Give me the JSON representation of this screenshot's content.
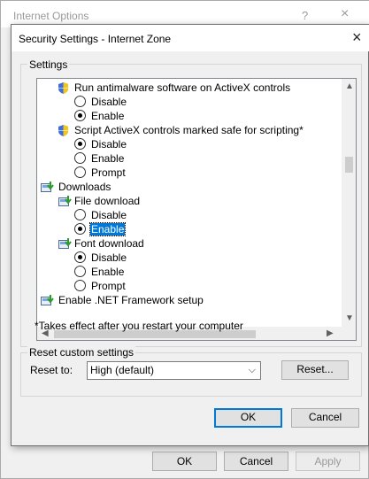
{
  "background_window": {
    "title": "Internet Options",
    "help_glyph": "?",
    "close_glyph": "×",
    "buttons": {
      "ok": "OK",
      "cancel": "Cancel",
      "apply": "Apply"
    }
  },
  "dialog": {
    "title": "Security Settings - Internet Zone",
    "close_glyph": "×",
    "settings_group_label": "Settings",
    "tree": {
      "rows": [
        {
          "kind": "setting",
          "icon": "shield-icon",
          "label": "Run antimalware software on ActiveX controls"
        },
        {
          "kind": "option",
          "label": "Disable",
          "checked": false
        },
        {
          "kind": "option",
          "label": "Enable",
          "checked": true
        },
        {
          "kind": "setting",
          "icon": "shield-icon",
          "label": "Script ActiveX controls marked safe for scripting*"
        },
        {
          "kind": "option",
          "label": "Disable",
          "checked": true
        },
        {
          "kind": "option",
          "label": "Enable",
          "checked": false
        },
        {
          "kind": "option",
          "label": "Prompt",
          "checked": false
        },
        {
          "kind": "category",
          "icon": "downloads-icon",
          "label": "Downloads"
        },
        {
          "kind": "setting",
          "icon": "download-setting-icon",
          "label": "File download"
        },
        {
          "kind": "option",
          "label": "Disable",
          "checked": false
        },
        {
          "kind": "option",
          "label": "Enable",
          "checked": true,
          "selected": true
        },
        {
          "kind": "setting",
          "icon": "download-setting-icon",
          "label": "Font download"
        },
        {
          "kind": "option",
          "label": "Disable",
          "checked": true
        },
        {
          "kind": "option",
          "label": "Enable",
          "checked": false
        },
        {
          "kind": "option",
          "label": "Prompt",
          "checked": false
        },
        {
          "kind": "category",
          "icon": "downloads-icon",
          "label": "Enable .NET Framework setup"
        }
      ]
    },
    "note": "*Takes effect after you restart your computer",
    "reset_group_label": "Reset custom settings",
    "reset_to_label": "Reset to:",
    "reset_select_value": "High (default)",
    "reset_button": "Reset...",
    "ok_button": "OK",
    "cancel_button": "Cancel"
  },
  "colors": {
    "selection": "#0078d7",
    "default_button_border": "#0078d7",
    "shield_blue": "#3d6fd4",
    "shield_yellow": "#f5c518"
  }
}
